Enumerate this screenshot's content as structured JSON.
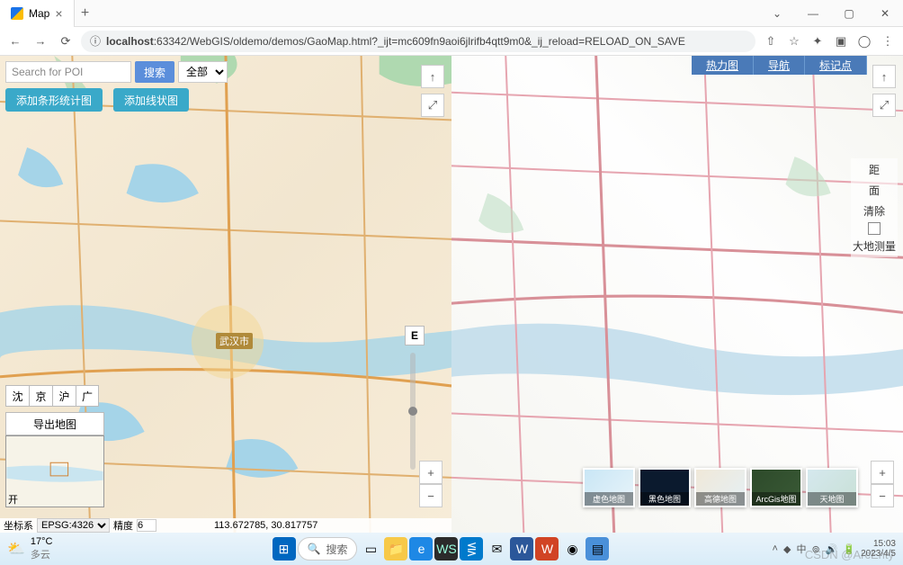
{
  "window": {
    "title": "Map",
    "min": "—",
    "max": "▢",
    "close": "✕",
    "chevron": "⌄"
  },
  "nav": {
    "back": "←",
    "fwd": "→",
    "reload": "⟳",
    "host": "localhost",
    "port_path": ":63342/WebGIS/oldemo/demos/GaoMap.html?_ijt=mc609fn9aoi6jlrifb4qtt9m0&_ij_reload=RELOAD_ON_SAVE",
    "info": "ⓘ"
  },
  "left": {
    "search_ph": "Search for POI",
    "search_btn": "搜索",
    "cat": "全部",
    "add_bar": "添加条形统计图",
    "add_line": "添加线状图",
    "e_btn": "E",
    "cities": [
      "沈",
      "京",
      "沪",
      "广"
    ],
    "export": "导出地图",
    "ov_toggle": "开",
    "city_label": "武汉市"
  },
  "status": {
    "crs_lbl": "坐标系",
    "crs": "EPSG:4326",
    "prec_lbl": "精度",
    "prec": "6",
    "coord": "113.672785, 30.817757"
  },
  "right": {
    "links": [
      "热力图",
      "导航",
      "标记点"
    ],
    "side": [
      "距",
      "面",
      "清除",
      "大地测量"
    ],
    "layers": [
      "虚色地图",
      "黑色地图",
      "高德地图",
      "ArcGis地图",
      "天地图"
    ]
  },
  "ctl": {
    "north": "↑",
    "full": "⤢",
    "plus": "+",
    "minus": "−"
  },
  "taskbar": {
    "temp": "17°C",
    "weather": "多云",
    "search": "搜索",
    "ime": "中",
    "watermark_a": "CSDN",
    "watermark_b": "@ArcEnty",
    "time": "15:03",
    "date": "2023/4/5"
  }
}
